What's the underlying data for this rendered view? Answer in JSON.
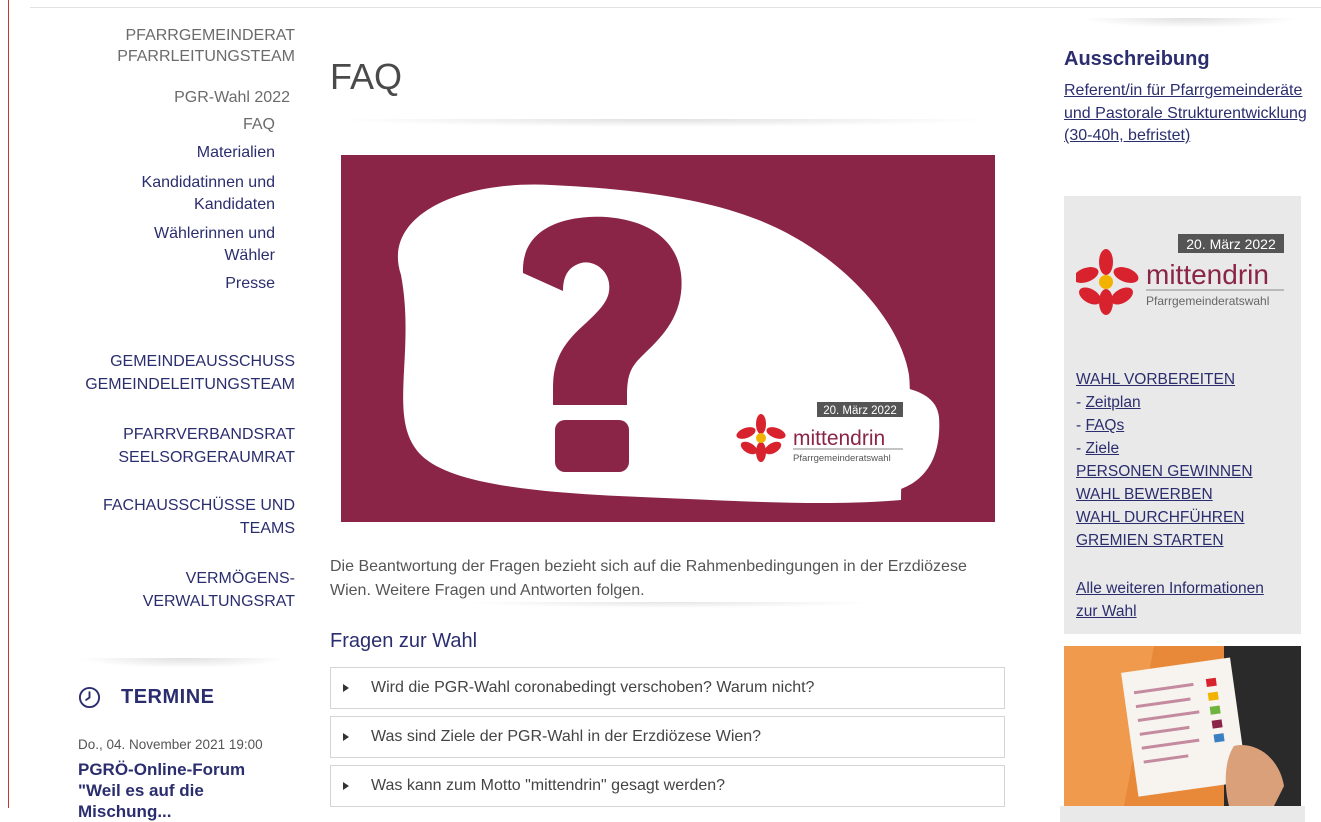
{
  "left_nav": {
    "group1": [
      "PFARRGEMEINDERAT",
      "PFARRLEITUNGSTEAM"
    ],
    "sub_items": [
      "PGR-Wahl 2022",
      "FAQ",
      "Materialien",
      "Kandidatinnen und",
      "Kandidaten",
      "Wählerinnen und",
      "Wähler",
      "Presse"
    ],
    "group2": [
      "GEMEINDEAUSSCHUSS",
      "GEMEINDELEITUNGSTEAM"
    ],
    "group3": [
      "PFARRVERBANDSRAT",
      "SEELSORGERAUMRAT"
    ],
    "group4": [
      "FACHAUSSCHÜSSE UND",
      "TEAMS"
    ],
    "group5": [
      "VERMÖGENS-",
      "VERWALTUNGSRAT"
    ]
  },
  "termine": {
    "title": "TERMINE",
    "date": "Do., 04. November 2021 19:00",
    "event": "PGRÖ-Online-Forum \"Weil es auf die Mischung..."
  },
  "main": {
    "title": "FAQ",
    "intro": "Die Beantwortung der Fragen bezieht sich auf die Rahmenbedingungen in der Erzdiözese Wien. Weitere Fragen und Antworten folgen.",
    "section_title": "Fragen zur Wahl",
    "faq_items": [
      "Wird die PGR-Wahl coronabedingt verschoben? Warum nicht?",
      "Was sind Ziele der PGR-Wahl in der Erzdiözese Wien?",
      "Was kann zum Motto \"mittendrin\" gesagt werden?"
    ]
  },
  "hero_logo": {
    "date": "20. März 2022",
    "name": "mittendrin",
    "subtitle": "Pfarrgemeinderatswahl"
  },
  "sidebar": {
    "title": "Ausschreibung",
    "link": "Referent/in für Pfarrgemeinderäte und Pastorale Strukturentwicklung (30-40h, befristet)",
    "box": {
      "items": [
        {
          "prefix": "",
          "label": "WAHL VORBEREITEN"
        },
        {
          "prefix": "- ",
          "label": "Zeitplan"
        },
        {
          "prefix": "- ",
          "label": "FAQs"
        },
        {
          "prefix": "- ",
          "label": "Ziele"
        },
        {
          "prefix": "",
          "label": "PERSONEN GEWINNEN"
        },
        {
          "prefix": "",
          "label": "WAHL BEWERBEN"
        },
        {
          "prefix": "",
          "label": "WAHL DURCHFÜHREN"
        },
        {
          "prefix": "",
          "label": "GREMIEN STARTEN"
        }
      ],
      "more": "Alle weiteren Informationen zur Wahl"
    }
  },
  "colors": {
    "brand_purple": "#8a2548",
    "nav_blue": "#2b2e6e",
    "flower_red": "#d8232f",
    "sidebar_box": "#e9e9e9"
  }
}
